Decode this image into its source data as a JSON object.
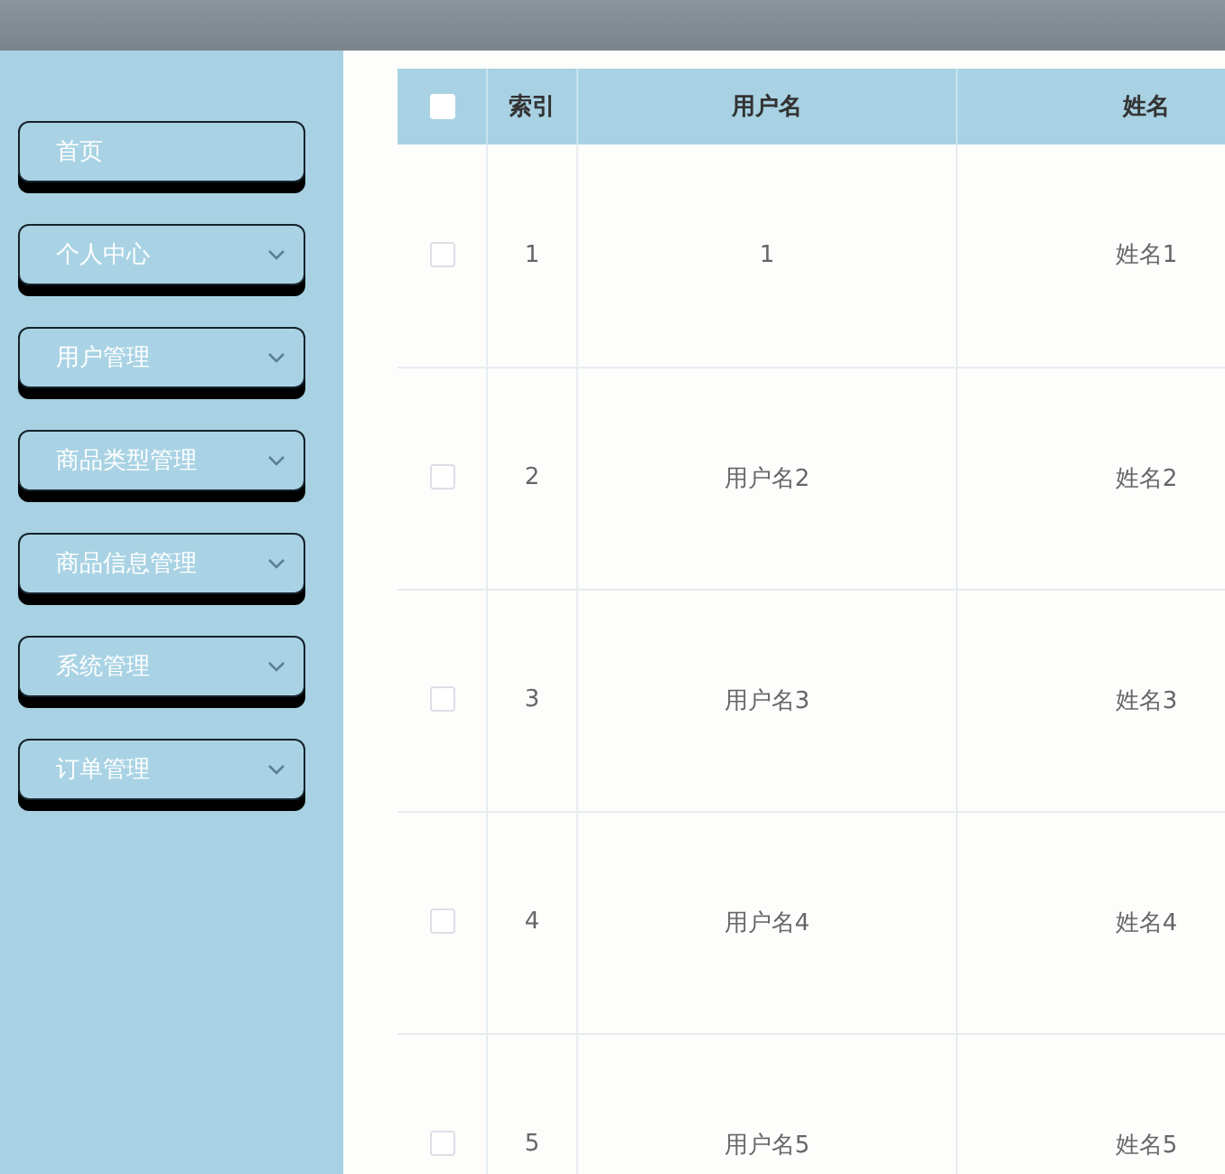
{
  "menu": [
    {
      "label": "首页",
      "expandable": false
    },
    {
      "label": "个人中心",
      "expandable": true
    },
    {
      "label": "用户管理",
      "expandable": true
    },
    {
      "label": "商品类型管理",
      "expandable": true
    },
    {
      "label": "商品信息管理",
      "expandable": true
    },
    {
      "label": "系统管理",
      "expandable": true
    },
    {
      "label": "订单管理",
      "expandable": true
    }
  ],
  "table": {
    "select_all": {
      "checked": false
    },
    "columns": [
      "索引",
      "用户名",
      "姓名"
    ],
    "rows": [
      {
        "checked": false,
        "cells": [
          "1",
          "1",
          "姓名1"
        ]
      },
      {
        "checked": false,
        "cells": [
          "2",
          "用户名2",
          "姓名2"
        ]
      },
      {
        "checked": false,
        "cells": [
          "3",
          "用户名3",
          "姓名3"
        ]
      },
      {
        "checked": false,
        "cells": [
          "4",
          "用户名4",
          "姓名4"
        ]
      },
      {
        "checked": false,
        "cells": [
          "5",
          "用户名5",
          "姓名5"
        ]
      }
    ]
  }
}
